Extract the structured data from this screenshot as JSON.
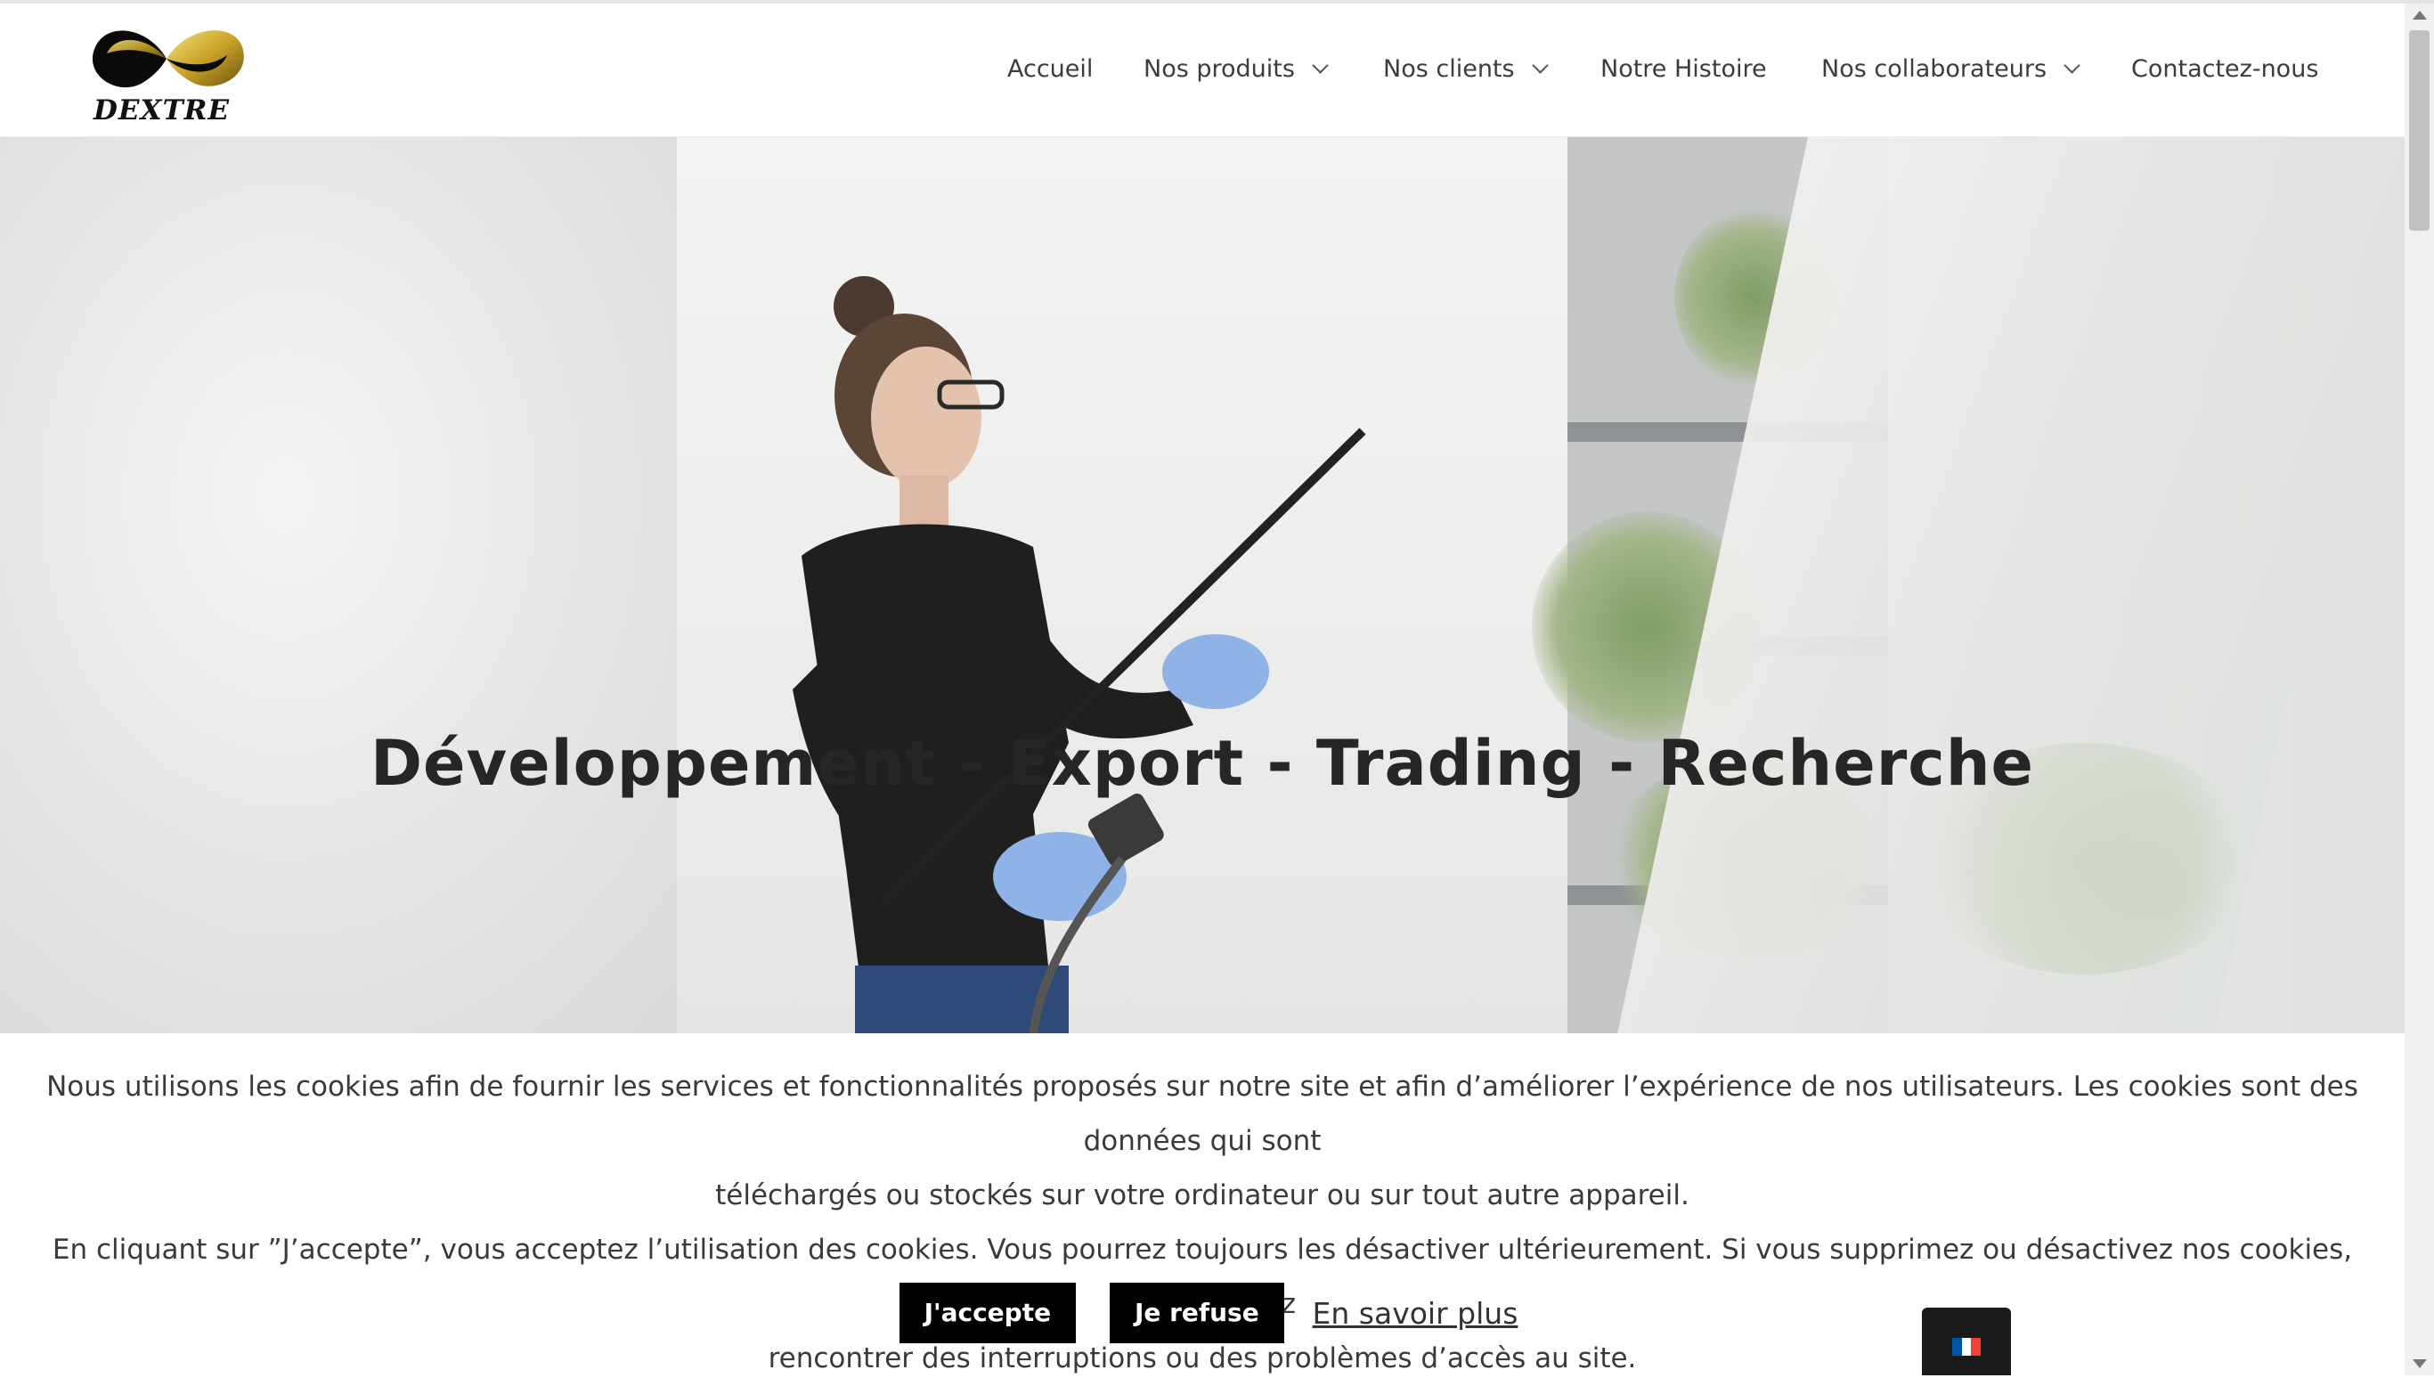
{
  "brand": {
    "name": "DEXTRE"
  },
  "nav": {
    "items": [
      {
        "label": "Accueil",
        "dropdown": false
      },
      {
        "label": "Nos produits",
        "dropdown": true
      },
      {
        "label": "Nos clients",
        "dropdown": true
      },
      {
        "label": "Notre Histoire",
        "dropdown": false
      },
      {
        "label": "Nos collaborateurs",
        "dropdown": true
      },
      {
        "label": "Contactez-nous",
        "dropdown": false
      }
    ]
  },
  "hero": {
    "title": "Développement - Export - Trading - Recherche"
  },
  "cookie_banner": {
    "line1": "Nous utilisons les cookies afin de fournir les services et fonctionnalités proposés sur notre site et afin d’améliorer l’expérience de nos utilisateurs. Les cookies sont des données qui sont",
    "line2": "téléchargés ou stockés sur votre ordinateur ou sur tout autre appareil.",
    "line3": "En cliquant sur ”J’accepte”, vous acceptez l’utilisation des cookies. Vous pourrez toujours les désactiver ultérieurement. Si vous supprimez ou désactivez nos cookies, vous pourriez",
    "line4": "rencontrer des interruptions ou des problèmes d’accès au site.",
    "accept_label": "J'accepte",
    "refuse_label": "Je refuse",
    "more_label": "En savoir plus"
  },
  "language": {
    "current": "fr",
    "icon": "france-flag-icon"
  },
  "colors": {
    "accent": "#000000",
    "logo_gold": "#c9a227",
    "text": "#3a3a3a"
  }
}
